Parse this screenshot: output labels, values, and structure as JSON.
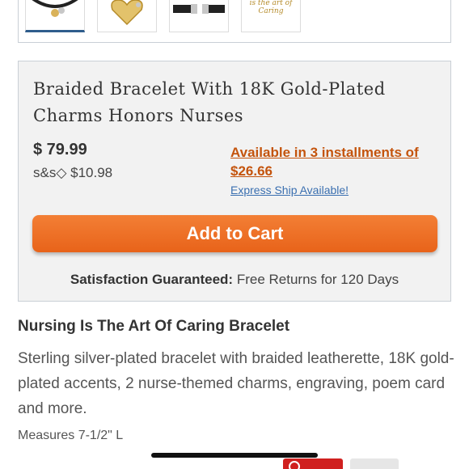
{
  "thumbnails": [
    {
      "name": "bracelet-full",
      "selected": true
    },
    {
      "name": "heart-charm",
      "selected": false
    },
    {
      "name": "leather-clasp",
      "selected": false
    },
    {
      "name": "poem-card",
      "selected": false,
      "card_text": "is the art of Caring"
    }
  ],
  "product": {
    "title": "Braided Bracelet With 18K Gold-Plated Charms Honors Nurses",
    "price": "$ 79.99",
    "shipping_label": "s&s◇ $10.98",
    "installments": "Available in 3 installments of $26.66",
    "express": "Express Ship Available!",
    "add_to_cart": "Add to Cart",
    "guarantee_bold": "Satisfaction Guaranteed:",
    "guarantee_rest": " Free Returns for 120 Days"
  },
  "description": {
    "title": "Nursing Is The Art Of Caring Bracelet",
    "body": "Sterling silver-plated bracelet with braided leatherette, 18K gold-plated accents, 2 nurse-themed charms, engraving, poem card and more.",
    "measures": "Measures 7-1/2\" L"
  },
  "colors": {
    "accent_orange": "#e8631a",
    "installment_orange": "#c4540d",
    "link_blue": "#3a6fb0",
    "pin_red": "#d0201f"
  }
}
